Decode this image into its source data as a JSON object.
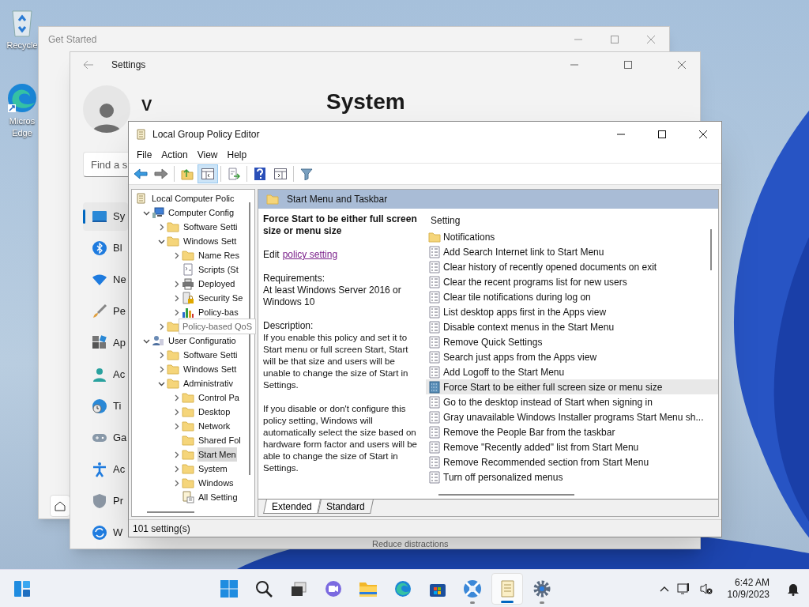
{
  "desktop_icons": [
    {
      "kind": "recycle",
      "label": "Recycle"
    },
    {
      "kind": "edge",
      "label": "Micros Edge"
    }
  ],
  "get_started": {
    "title": "Get Started"
  },
  "settings": {
    "title": "Settings",
    "user": "V",
    "heading": "System",
    "search": {
      "placeholder": "Find a s"
    },
    "nav": [
      {
        "kind": "system",
        "label": "Sy",
        "selected": true
      },
      {
        "kind": "bluetooth",
        "label": "Bl",
        "selected": false
      },
      {
        "kind": "network",
        "label": "Ne",
        "selected": false
      },
      {
        "kind": "brush",
        "label": "Pe",
        "selected": false
      },
      {
        "kind": "apps",
        "label": "Ap",
        "selected": false
      },
      {
        "kind": "account",
        "label": "Ac",
        "selected": false
      },
      {
        "kind": "time",
        "label": "Ti",
        "selected": false
      },
      {
        "kind": "gaming",
        "label": "Ga",
        "selected": false
      },
      {
        "kind": "accessibility",
        "label": "Ac",
        "selected": false
      },
      {
        "kind": "privacy",
        "label": "Pr",
        "selected": false
      },
      {
        "kind": "update",
        "label": "W",
        "selected": false
      }
    ],
    "main_peek": "Reduce distractions"
  },
  "gpedit": {
    "title": "Local Group Policy Editor",
    "menu": [
      "File",
      "Action",
      "View",
      "Help"
    ],
    "toolbar": [
      {
        "kind": "back",
        "pressed": false
      },
      {
        "kind": "forward",
        "pressed": false
      },
      {
        "kind": "sep"
      },
      {
        "kind": "up",
        "pressed": false
      },
      {
        "kind": "tree",
        "pressed": true
      },
      {
        "kind": "sep"
      },
      {
        "kind": "export",
        "pressed": false
      },
      {
        "kind": "sep"
      },
      {
        "kind": "help",
        "pressed": false
      },
      {
        "kind": "view",
        "pressed": false
      },
      {
        "kind": "sep"
      },
      {
        "kind": "filter",
        "pressed": false
      }
    ],
    "tree": [
      {
        "kind": "doc",
        "label": "Local Computer Polic",
        "selected": false,
        "children": [
          {
            "kind": "computer",
            "label": "Computer Config",
            "expanded": true,
            "selected": false,
            "children": [
              {
                "kind": "folder",
                "label": "Software Setti",
                "expanded": false,
                "selected": false
              },
              {
                "kind": "folder",
                "label": "Windows Sett",
                "expanded": true,
                "selected": false,
                "children": [
                  {
                    "kind": "folder",
                    "label": "Name Res",
                    "expanded": false,
                    "selected": false
                  },
                  {
                    "kind": "scripts",
                    "label": "Scripts (St",
                    "selected": false
                  },
                  {
                    "kind": "printer",
                    "label": "Deployed",
                    "expanded": false,
                    "selected": false
                  },
                  {
                    "kind": "security",
                    "label": "Security Se",
                    "expanded": false,
                    "selected": false
                  },
                  {
                    "kind": "chart",
                    "label": "Policy-bas",
                    "expanded": false,
                    "selected": false
                  }
                ]
              },
              {
                "kind": "folder",
                "tooltip": "Policy-based QoS",
                "expanded": false,
                "selected": false
              }
            ]
          },
          {
            "kind": "user",
            "label": "User Configuratio",
            "expanded": true,
            "selected": false,
            "children": [
              {
                "kind": "folder",
                "label": "Software Setti",
                "expanded": false,
                "selected": false
              },
              {
                "kind": "folder",
                "label": "Windows Sett",
                "expanded": false,
                "selected": false
              },
              {
                "kind": "folder",
                "label": "Administrativ",
                "expanded": true,
                "selected": false,
                "children": [
                  {
                    "kind": "folder",
                    "label": "Control Pa",
                    "expanded": false,
                    "selected": false
                  },
                  {
                    "kind": "folder",
                    "label": "Desktop",
                    "expanded": false,
                    "selected": false
                  },
                  {
                    "kind": "folder",
                    "label": "Network",
                    "expanded": false,
                    "selected": false
                  },
                  {
                    "kind": "folder",
                    "label": "Shared Fol",
                    "selected": false
                  },
                  {
                    "kind": "folder",
                    "label": "Start Men",
                    "expanded": false,
                    "selected": true
                  },
                  {
                    "kind": "folder",
                    "label": "System",
                    "expanded": false,
                    "selected": false
                  },
                  {
                    "kind": "folder",
                    "label": "Windows",
                    "expanded": false,
                    "selected": false
                  },
                  {
                    "kind": "allsettings",
                    "label": "All Setting",
                    "selected": false
                  }
                ]
              }
            ]
          }
        ]
      }
    ],
    "pane_header": "Start Menu and Taskbar",
    "detail": {
      "title": "Force Start to be either full screen size or menu size",
      "edit_prefix": "Edit",
      "edit_link": "policy setting",
      "requirements_label": "Requirements:",
      "requirements": "At least Windows Server 2016 or Windows 10",
      "description_label": "Description:",
      "paragraphs": [
        "If you enable this policy and set it to Start menu or full screen Start, Start will be that size and users will be unable to change the size of Start in Settings.",
        "If you disable or don't configure this policy setting, Windows will automatically select the size based on hardware form factor and users will be able to change the size of Start in Settings."
      ]
    },
    "list_header": "Setting",
    "settings_list": [
      {
        "kind": "folder",
        "label": "Notifications",
        "selected": false
      },
      {
        "kind": "policy",
        "label": "Add Search Internet link to Start Menu",
        "selected": false
      },
      {
        "kind": "policy",
        "label": "Clear history of recently opened documents on exit",
        "selected": false
      },
      {
        "kind": "policy",
        "label": "Clear the recent programs list for new users",
        "selected": false
      },
      {
        "kind": "policy",
        "label": "Clear tile notifications during log on",
        "selected": false
      },
      {
        "kind": "policy",
        "label": "List desktop apps first in the Apps view",
        "selected": false
      },
      {
        "kind": "policy",
        "label": "Disable context menus in the Start Menu",
        "selected": false
      },
      {
        "kind": "policy",
        "label": "Remove Quick Settings",
        "selected": false
      },
      {
        "kind": "policy",
        "label": "Search just apps from the Apps view",
        "selected": false
      },
      {
        "kind": "policy",
        "label": "Add Logoff to the Start Menu",
        "selected": false
      },
      {
        "kind": "policy",
        "label": "Force Start to be either full screen size or menu size",
        "selected": true
      },
      {
        "kind": "policy",
        "label": "Go to the desktop instead of Start when signing in",
        "selected": false
      },
      {
        "kind": "policy",
        "label": "Gray unavailable Windows Installer programs Start Menu sh...",
        "selected": false
      },
      {
        "kind": "policy",
        "label": "Remove the People Bar from the taskbar",
        "selected": false
      },
      {
        "kind": "policy",
        "label": "Remove \"Recently added\" list from Start Menu",
        "selected": false
      },
      {
        "kind": "policy",
        "label": "Remove Recommended section from Start Menu",
        "selected": false
      },
      {
        "kind": "policy",
        "label": "Turn off personalized menus",
        "selected": false
      }
    ],
    "tabs": [
      {
        "label": "Extended",
        "selected": true
      },
      {
        "label": "Standard",
        "selected": false
      }
    ],
    "status": "101 setting(s)"
  },
  "taskbar": {
    "widgets": {
      "kind": "widgets"
    },
    "apps": [
      {
        "kind": "start",
        "running": false,
        "active": false
      },
      {
        "kind": "search",
        "running": false,
        "active": false
      },
      {
        "kind": "taskview",
        "running": false,
        "active": false
      },
      {
        "kind": "chat",
        "running": false,
        "active": false
      },
      {
        "kind": "explorer",
        "running": false,
        "active": false
      },
      {
        "kind": "edge",
        "running": false,
        "active": false
      },
      {
        "kind": "store",
        "running": false,
        "active": false
      },
      {
        "kind": "app",
        "running": true,
        "active": false
      },
      {
        "kind": "gpedit",
        "running": true,
        "active": true
      },
      {
        "kind": "settings",
        "running": true,
        "active": false
      }
    ],
    "time": "6:42 AM",
    "date": "10/9/2023"
  }
}
